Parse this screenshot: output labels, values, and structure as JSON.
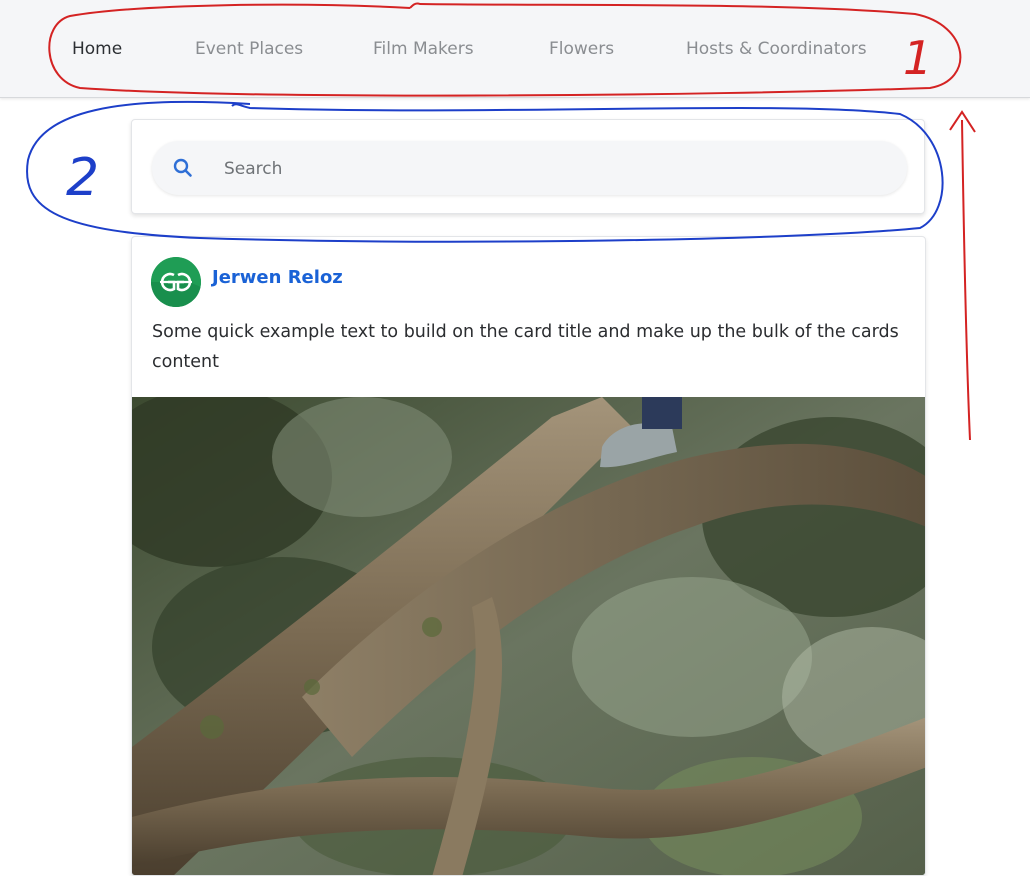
{
  "navbar": {
    "items": [
      {
        "label": "Home",
        "active": true
      },
      {
        "label": "Event Places",
        "active": false
      },
      {
        "label": "Film Makers",
        "active": false
      },
      {
        "label": "Flowers",
        "active": false
      },
      {
        "label": "Hosts & Coordinators",
        "active": false
      }
    ]
  },
  "search": {
    "placeholder": "Search",
    "value": "",
    "icon": "search-icon"
  },
  "post": {
    "author": "Jerwen Reloz",
    "avatar_icon": "gg-logo-icon",
    "avatar_color": "#1f9d55",
    "text": "Some quick example text to build on the card title and make up the bulk of the cards content"
  },
  "annotations": {
    "nav_number": "1",
    "search_number": "2",
    "nav_color": "#d42323",
    "search_color": "#1d3fc9"
  },
  "colors": {
    "link_blue": "#1a62d6",
    "search_icon_blue": "#2f6fd6"
  }
}
